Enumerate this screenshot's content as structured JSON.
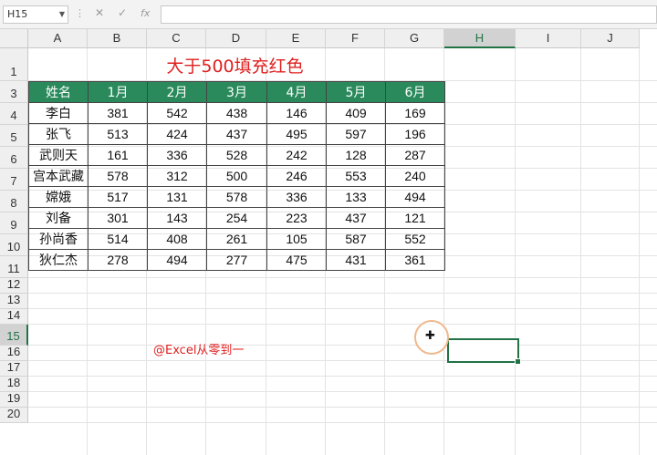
{
  "formula_bar": {
    "name_box": "H15",
    "cancel_icon": "✕",
    "enter_icon": "✓",
    "fx_label": "fx",
    "formula": ""
  },
  "columns": [
    "A",
    "B",
    "C",
    "D",
    "E",
    "F",
    "G",
    "H",
    "I",
    "J"
  ],
  "selected_column": "H",
  "rows": [
    "1",
    "3",
    "4",
    "5",
    "6",
    "7",
    "8",
    "9",
    "10",
    "11",
    "12",
    "13",
    "14",
    "15",
    "16",
    "17",
    "18",
    "19",
    "20"
  ],
  "selected_row": "15",
  "sheet": {
    "title": "大于500填充红色",
    "credit": "@Excel从零到一",
    "header": [
      "姓名",
      "1月",
      "2月",
      "3月",
      "4月",
      "5月",
      "6月"
    ],
    "rows": [
      [
        "李白",
        "381",
        "542",
        "438",
        "146",
        "409",
        "169"
      ],
      [
        "张飞",
        "513",
        "424",
        "437",
        "495",
        "597",
        "196"
      ],
      [
        "武则天",
        "161",
        "336",
        "528",
        "242",
        "128",
        "287"
      ],
      [
        "宫本武藏",
        "578",
        "312",
        "500",
        "246",
        "553",
        "240"
      ],
      [
        "嫦娥",
        "517",
        "131",
        "578",
        "336",
        "133",
        "494"
      ],
      [
        "刘备",
        "301",
        "143",
        "254",
        "223",
        "437",
        "121"
      ],
      [
        "孙尚香",
        "514",
        "408",
        "261",
        "105",
        "587",
        "552"
      ],
      [
        "狄仁杰",
        "278",
        "494",
        "277",
        "475",
        "431",
        "361"
      ]
    ]
  },
  "colors": {
    "header_fill": "#2a8a5c",
    "title_text": "#e02020",
    "accent": "#217346"
  }
}
